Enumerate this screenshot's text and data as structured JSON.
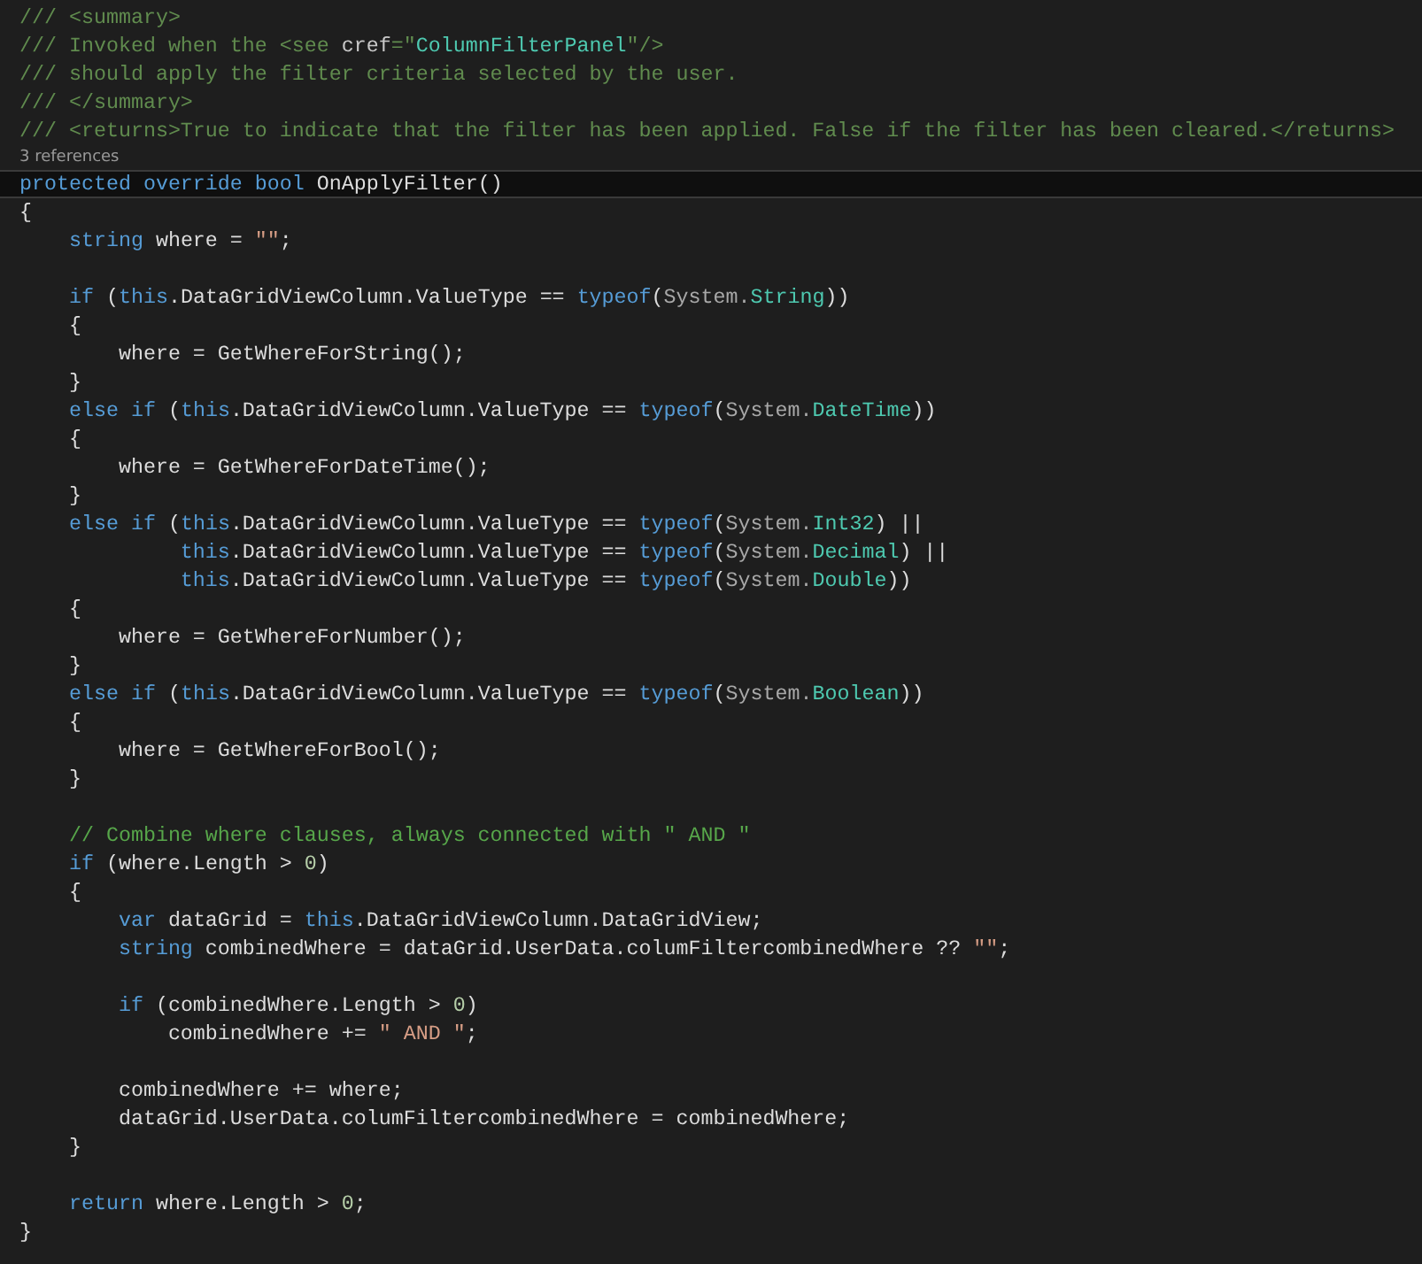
{
  "editor": {
    "lines": [
      {
        "kind": "code",
        "tokens": [
          {
            "kind": "doc",
            "text": "/// <summary>"
          }
        ]
      },
      {
        "kind": "code",
        "tokens": [
          {
            "kind": "doc",
            "text": "/// Invoked when the <see "
          },
          {
            "kind": "attr",
            "text": "cref"
          },
          {
            "kind": "doc",
            "text": "=\""
          },
          {
            "kind": "docval",
            "text": "ColumnFilterPanel"
          },
          {
            "kind": "doc",
            "text": "\"/>"
          }
        ]
      },
      {
        "kind": "code",
        "tokens": [
          {
            "kind": "doc",
            "text": "/// should apply the filter criteria selected by the user."
          }
        ]
      },
      {
        "kind": "code",
        "tokens": [
          {
            "kind": "doc",
            "text": "/// </summary>"
          }
        ]
      },
      {
        "kind": "code",
        "tokens": [
          {
            "kind": "doc",
            "text": "/// <returns>True to indicate that the filter has been applied. False if the filter has been cleared.</returns>"
          }
        ]
      },
      {
        "kind": "references",
        "text": "3 references"
      },
      {
        "kind": "code",
        "current": true,
        "tokens": [
          {
            "kind": "kw",
            "text": "protected override bool"
          },
          {
            "kind": "plain",
            "text": " OnApplyFilter()"
          }
        ]
      },
      {
        "kind": "code",
        "tokens": [
          {
            "kind": "plain",
            "text": "{"
          }
        ]
      },
      {
        "kind": "code",
        "tokens": [
          {
            "kind": "kw",
            "text": "    string"
          },
          {
            "kind": "plain",
            "text": " where = "
          },
          {
            "kind": "str",
            "text": "\"\""
          },
          {
            "kind": "plain",
            "text": ";"
          }
        ]
      },
      {
        "kind": "blank"
      },
      {
        "kind": "code",
        "tokens": [
          {
            "kind": "kw",
            "text": "    if"
          },
          {
            "kind": "plain",
            "text": " ("
          },
          {
            "kind": "kw",
            "text": "this"
          },
          {
            "kind": "plain",
            "text": ".DataGridViewColumn.ValueType == "
          },
          {
            "kind": "kw",
            "text": "typeof"
          },
          {
            "kind": "plain",
            "text": "("
          },
          {
            "kind": "ns",
            "text": "System."
          },
          {
            "kind": "type",
            "text": "String"
          },
          {
            "kind": "plain",
            "text": "))"
          }
        ]
      },
      {
        "kind": "code",
        "tokens": [
          {
            "kind": "plain",
            "text": "    {"
          }
        ]
      },
      {
        "kind": "code",
        "tokens": [
          {
            "kind": "plain",
            "text": "        where = GetWhereForString();"
          }
        ]
      },
      {
        "kind": "code",
        "tokens": [
          {
            "kind": "plain",
            "text": "    }"
          }
        ]
      },
      {
        "kind": "code",
        "tokens": [
          {
            "kind": "kw",
            "text": "    else if"
          },
          {
            "kind": "plain",
            "text": " ("
          },
          {
            "kind": "kw",
            "text": "this"
          },
          {
            "kind": "plain",
            "text": ".DataGridViewColumn.ValueType == "
          },
          {
            "kind": "kw",
            "text": "typeof"
          },
          {
            "kind": "plain",
            "text": "("
          },
          {
            "kind": "ns",
            "text": "System."
          },
          {
            "kind": "type",
            "text": "DateTime"
          },
          {
            "kind": "plain",
            "text": "))"
          }
        ]
      },
      {
        "kind": "code",
        "tokens": [
          {
            "kind": "plain",
            "text": "    {"
          }
        ]
      },
      {
        "kind": "code",
        "tokens": [
          {
            "kind": "plain",
            "text": "        where = GetWhereForDateTime();"
          }
        ]
      },
      {
        "kind": "code",
        "tokens": [
          {
            "kind": "plain",
            "text": "    }"
          }
        ]
      },
      {
        "kind": "code",
        "tokens": [
          {
            "kind": "kw",
            "text": "    else if"
          },
          {
            "kind": "plain",
            "text": " ("
          },
          {
            "kind": "kw",
            "text": "this"
          },
          {
            "kind": "plain",
            "text": ".DataGridViewColumn.ValueType == "
          },
          {
            "kind": "kw",
            "text": "typeof"
          },
          {
            "kind": "plain",
            "text": "("
          },
          {
            "kind": "ns",
            "text": "System."
          },
          {
            "kind": "type",
            "text": "Int32"
          },
          {
            "kind": "plain",
            "text": ") ||"
          }
        ]
      },
      {
        "kind": "code",
        "tokens": [
          {
            "kind": "kw",
            "text": "             this"
          },
          {
            "kind": "plain",
            "text": ".DataGridViewColumn.ValueType == "
          },
          {
            "kind": "kw",
            "text": "typeof"
          },
          {
            "kind": "plain",
            "text": "("
          },
          {
            "kind": "ns",
            "text": "System."
          },
          {
            "kind": "type",
            "text": "Decimal"
          },
          {
            "kind": "plain",
            "text": ") ||"
          }
        ]
      },
      {
        "kind": "code",
        "tokens": [
          {
            "kind": "kw",
            "text": "             this"
          },
          {
            "kind": "plain",
            "text": ".DataGridViewColumn.ValueType == "
          },
          {
            "kind": "kw",
            "text": "typeof"
          },
          {
            "kind": "plain",
            "text": "("
          },
          {
            "kind": "ns",
            "text": "System."
          },
          {
            "kind": "type",
            "text": "Double"
          },
          {
            "kind": "plain",
            "text": "))"
          }
        ]
      },
      {
        "kind": "code",
        "tokens": [
          {
            "kind": "plain",
            "text": "    {"
          }
        ]
      },
      {
        "kind": "code",
        "tokens": [
          {
            "kind": "plain",
            "text": "        where = GetWhereForNumber();"
          }
        ]
      },
      {
        "kind": "code",
        "tokens": [
          {
            "kind": "plain",
            "text": "    }"
          }
        ]
      },
      {
        "kind": "code",
        "tokens": [
          {
            "kind": "kw",
            "text": "    else if"
          },
          {
            "kind": "plain",
            "text": " ("
          },
          {
            "kind": "kw",
            "text": "this"
          },
          {
            "kind": "plain",
            "text": ".DataGridViewColumn.ValueType == "
          },
          {
            "kind": "kw",
            "text": "typeof"
          },
          {
            "kind": "plain",
            "text": "("
          },
          {
            "kind": "ns",
            "text": "System."
          },
          {
            "kind": "type",
            "text": "Boolean"
          },
          {
            "kind": "plain",
            "text": "))"
          }
        ]
      },
      {
        "kind": "code",
        "tokens": [
          {
            "kind": "plain",
            "text": "    {"
          }
        ]
      },
      {
        "kind": "code",
        "tokens": [
          {
            "kind": "plain",
            "text": "        where = GetWhereForBool();"
          }
        ]
      },
      {
        "kind": "code",
        "tokens": [
          {
            "kind": "plain",
            "text": "    }"
          }
        ]
      },
      {
        "kind": "blank"
      },
      {
        "kind": "code",
        "tokens": [
          {
            "kind": "comment",
            "text": "    // Combine where clauses, always connected with \" AND \""
          }
        ]
      },
      {
        "kind": "code",
        "tokens": [
          {
            "kind": "kw",
            "text": "    if"
          },
          {
            "kind": "plain",
            "text": " (where.Length > "
          },
          {
            "kind": "num",
            "text": "0"
          },
          {
            "kind": "plain",
            "text": ")"
          }
        ]
      },
      {
        "kind": "code",
        "tokens": [
          {
            "kind": "plain",
            "text": "    {"
          }
        ]
      },
      {
        "kind": "code",
        "tokens": [
          {
            "kind": "kw",
            "text": "        var"
          },
          {
            "kind": "plain",
            "text": " dataGrid = "
          },
          {
            "kind": "kw",
            "text": "this"
          },
          {
            "kind": "plain",
            "text": ".DataGridViewColumn.DataGridView;"
          }
        ]
      },
      {
        "kind": "code",
        "tokens": [
          {
            "kind": "kw",
            "text": "        string"
          },
          {
            "kind": "plain",
            "text": " combinedWhere = dataGrid.UserData.columFiltercombinedWhere ?? "
          },
          {
            "kind": "str",
            "text": "\"\""
          },
          {
            "kind": "plain",
            "text": ";"
          }
        ]
      },
      {
        "kind": "blank"
      },
      {
        "kind": "code",
        "tokens": [
          {
            "kind": "kw",
            "text": "        if"
          },
          {
            "kind": "plain",
            "text": " (combinedWhere.Length > "
          },
          {
            "kind": "num",
            "text": "0"
          },
          {
            "kind": "plain",
            "text": ")"
          }
        ]
      },
      {
        "kind": "code",
        "tokens": [
          {
            "kind": "plain",
            "text": "            combinedWhere += "
          },
          {
            "kind": "str",
            "text": "\" AND \""
          },
          {
            "kind": "plain",
            "text": ";"
          }
        ]
      },
      {
        "kind": "blank"
      },
      {
        "kind": "code",
        "tokens": [
          {
            "kind": "plain",
            "text": "        combinedWhere += where;"
          }
        ]
      },
      {
        "kind": "code",
        "tokens": [
          {
            "kind": "plain",
            "text": "        dataGrid.UserData.columFiltercombinedWhere = combinedWhere;"
          }
        ]
      },
      {
        "kind": "code",
        "tokens": [
          {
            "kind": "plain",
            "text": "    }"
          }
        ]
      },
      {
        "kind": "blank"
      },
      {
        "kind": "code",
        "tokens": [
          {
            "kind": "kw",
            "text": "    return"
          },
          {
            "kind": "plain",
            "text": " where.Length > "
          },
          {
            "kind": "num",
            "text": "0"
          },
          {
            "kind": "plain",
            "text": ";"
          }
        ]
      },
      {
        "kind": "code",
        "tokens": [
          {
            "kind": "plain",
            "text": "}"
          }
        ]
      }
    ]
  }
}
